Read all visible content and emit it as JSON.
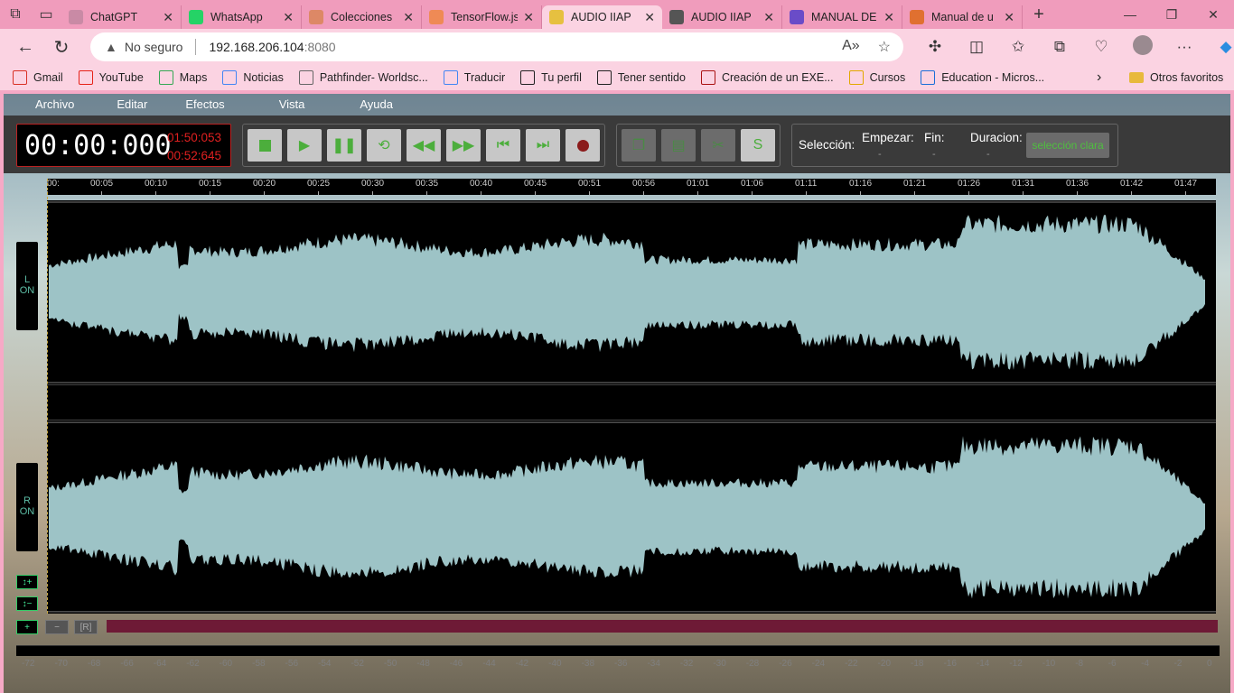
{
  "browser": {
    "tabs": [
      {
        "label": "ChatGPT",
        "icon": "chatgpt-icon",
        "color": "#c98aa5"
      },
      {
        "label": "WhatsApp",
        "icon": "whatsapp-icon",
        "color": "#25d366"
      },
      {
        "label": "Colecciones",
        "icon": "collections-icon",
        "color": "#d86"
      },
      {
        "label": "TensorFlow.js",
        "icon": "tensorflow-icon",
        "color": "#ef8a55"
      },
      {
        "label": "AUDIO IIAP",
        "icon": "audio-icon",
        "color": "#e6c040",
        "active": true
      },
      {
        "label": "AUDIO IIAP",
        "icon": "document-icon",
        "color": "#555"
      },
      {
        "label": "MANUAL DE",
        "icon": "search-icon",
        "color": "#6a4cc8"
      },
      {
        "label": "Manual de u",
        "icon": "calendar-icon",
        "color": "#e07030"
      }
    ],
    "security_label": "No seguro",
    "url_host": "192.168.206.104",
    "url_port": ":8080",
    "bookmarks": [
      {
        "label": "Gmail",
        "icon": "gmail-icon",
        "color": "#d93025"
      },
      {
        "label": "YouTube",
        "icon": "youtube-icon",
        "color": "#e62117"
      },
      {
        "label": "Maps",
        "icon": "maps-icon",
        "color": "#34a853"
      },
      {
        "label": "Noticias",
        "icon": "news-icon",
        "color": "#4285f4"
      },
      {
        "label": "Pathfinder- Worldsc...",
        "icon": "page-icon",
        "color": "#666"
      },
      {
        "label": "Traducir",
        "icon": "translate-icon",
        "color": "#4285f4"
      },
      {
        "label": "Tu perfil",
        "icon": "github-icon",
        "color": "#222"
      },
      {
        "label": "Tener sentido",
        "icon": "page-icon",
        "color": "#222"
      },
      {
        "label": "Creación de un EXE...",
        "icon": "page-icon",
        "color": "#a11"
      },
      {
        "label": "Cursos",
        "icon": "chart-icon",
        "color": "#e2a800"
      },
      {
        "label": "Education - Micros...",
        "icon": "azure-icon",
        "color": "#1a6ed8"
      }
    ],
    "other_favorites": "Otros favoritos"
  },
  "app": {
    "menu": [
      "Archivo",
      "Editar",
      "Efectos",
      "Vista",
      "Ayuda"
    ],
    "clock": {
      "time": "00:00:000",
      "total": "01:50:053",
      "position": "00:52:645"
    },
    "selection": {
      "title": "Selección:",
      "start": "Empezar:",
      "end": "Fin:",
      "duration": "Duracion:",
      "start_val": "-",
      "end_val": "-",
      "duration_val": "-",
      "clear_label": "selección clara"
    },
    "ruler_labels": [
      "00:",
      "00:05",
      "00:10",
      "00:15",
      "00:20",
      "00:25",
      "00:30",
      "00:35",
      "00:40",
      "00:45",
      "00:51",
      "00:56",
      "01:01",
      "01:06",
      "01:11",
      "01:16",
      "01:21",
      "01:26",
      "01:31",
      "01:36",
      "01:42",
      "01:47"
    ],
    "channels": [
      {
        "letter": "L",
        "state": "ON"
      },
      {
        "letter": "R",
        "state": "ON"
      }
    ],
    "zoom_buttons": [
      "↕+",
      "↕−"
    ],
    "bottom_buttons": [
      "+",
      "−",
      "[R]"
    ],
    "db_labels": [
      "-72",
      "-70",
      "-68",
      "-66",
      "-64",
      "-62",
      "-60",
      "-58",
      "-56",
      "-54",
      "-52",
      "-50",
      "-48",
      "-46",
      "-44",
      "-42",
      "-40",
      "-38",
      "-36",
      "-34",
      "-32",
      "-30",
      "-28",
      "-26",
      "-24",
      "-22",
      "-20",
      "-18",
      "-16",
      "-14",
      "-12",
      "-10",
      "-8",
      "-6",
      "-4",
      "-2",
      "0"
    ],
    "colors": {
      "waveform": "#9dc3c6",
      "clock_red": "#e02020",
      "scrollbar": "#6e1a36",
      "button_green": "#4cae3c"
    }
  }
}
